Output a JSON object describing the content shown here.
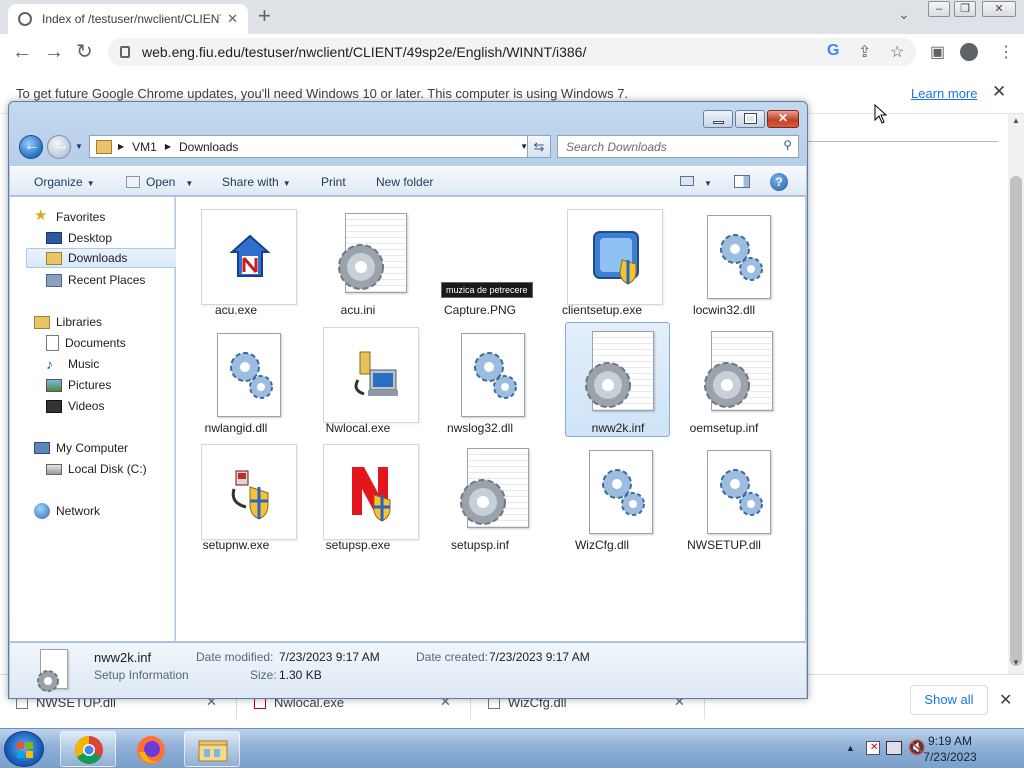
{
  "browser": {
    "tab_title": "Index of /testuser/nwclient/CLIENT",
    "new_tab_label": "+",
    "url": "web.eng.fiu.edu/testuser/nwclient/CLIENT/49sp2e/English/WINNT/i386/",
    "infobar_message": "To get future Google Chrome updates, you'll need Windows 10 or later. This computer is using Windows 7.",
    "infobar_link": "Learn more"
  },
  "downloads_bar": {
    "items": [
      "NWSETUP.dll",
      "Nwlocal.exe",
      "WizCfg.dll"
    ],
    "show_all": "Show all"
  },
  "explorer": {
    "breadcrumb": [
      "VM1",
      "Downloads"
    ],
    "search_placeholder": "Search Downloads",
    "commands": {
      "organize": "Organize",
      "open": "Open",
      "share_with": "Share with",
      "print": "Print",
      "new_folder": "New folder"
    },
    "nav": {
      "favorites": "Favorites",
      "desktop": "Desktop",
      "downloads": "Downloads",
      "recent_places": "Recent Places",
      "libraries": "Libraries",
      "documents": "Documents",
      "music": "Music",
      "pictures": "Pictures",
      "videos": "Videos",
      "my_computer": "My Computer",
      "local_disk": "Local Disk (C:)",
      "network": "Network"
    },
    "files": [
      {
        "name": "acu.exe",
        "icon": "novell-client-icon"
      },
      {
        "name": "acu.ini",
        "icon": "config-file-icon"
      },
      {
        "name": "Capture.PNG",
        "icon": "image-file-icon"
      },
      {
        "name": "clientsetup.exe",
        "icon": "installer-shield-icon"
      },
      {
        "name": "locwin32.dll",
        "icon": "dll-file-icon"
      },
      {
        "name": "nwlangid.dll",
        "icon": "dll-file-icon"
      },
      {
        "name": "Nwlocal.exe",
        "icon": "computer-network-icon"
      },
      {
        "name": "nwslog32.dll",
        "icon": "dll-file-icon"
      },
      {
        "name": "nww2k.inf",
        "icon": "config-file-icon"
      },
      {
        "name": "oemsetup.inf",
        "icon": "config-file-icon"
      },
      {
        "name": "setupnw.exe",
        "icon": "setup-shield-icon"
      },
      {
        "name": "setupsp.exe",
        "icon": "novell-n-shield-icon"
      },
      {
        "name": "setupsp.inf",
        "icon": "config-file-icon"
      },
      {
        "name": "WizCfg.dll",
        "icon": "dll-file-icon"
      },
      {
        "name": "NWSETUP.dll",
        "icon": "dll-file-icon"
      }
    ],
    "selected_file": "nww2k.inf",
    "tooltip": "muzica de petrecere",
    "details": {
      "name": "nww2k.inf",
      "type": "Setup Information",
      "modified_label": "Date modified:",
      "modified_value": "7/23/2023 9:17 AM",
      "created_label": "Date created:",
      "created_value": "7/23/2023 9:17 AM",
      "size_label": "Size:",
      "size_value": "1.30 KB"
    }
  },
  "taskbar": {
    "time": "9:19 AM",
    "date": "7/23/2023"
  }
}
